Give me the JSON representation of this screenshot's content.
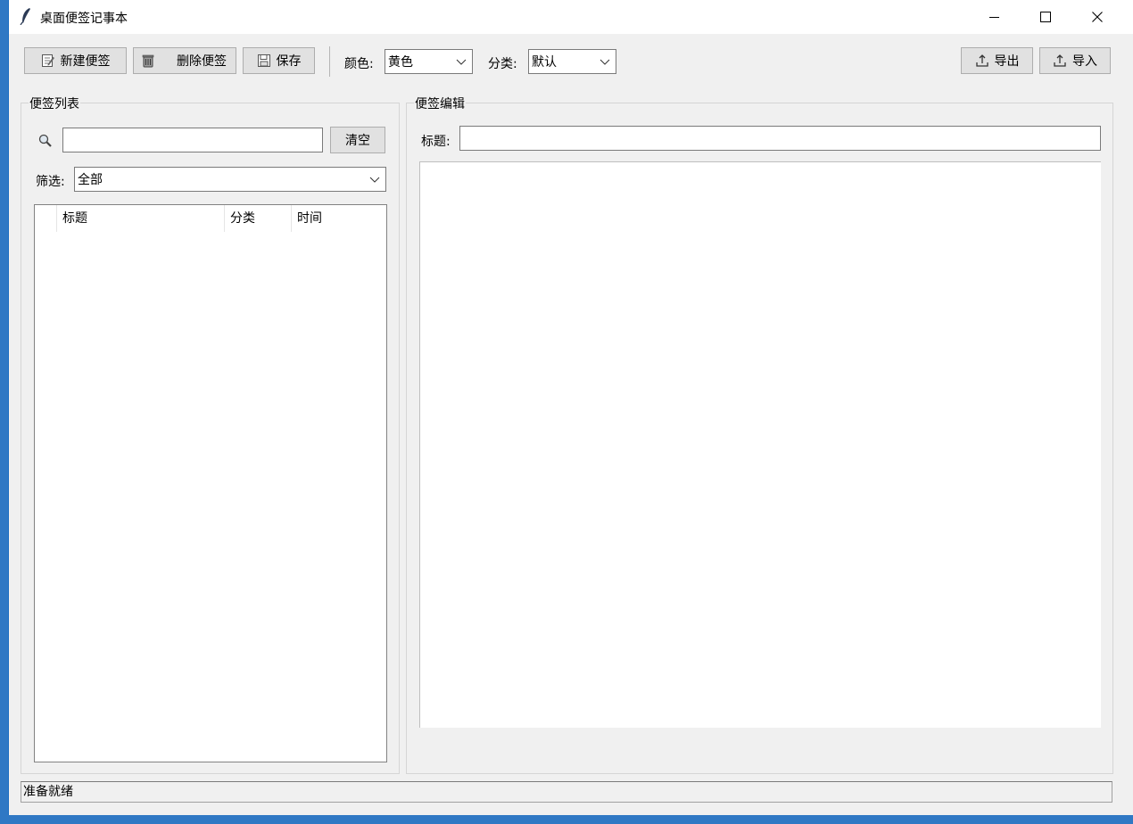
{
  "window": {
    "title": "桌面便签记事本",
    "icon": "feather-icon"
  },
  "toolbar": {
    "new_label": "新建便签",
    "delete_label": "删除便签",
    "save_label": "保存",
    "color_label": "颜色:",
    "color_value": "黄色",
    "category_label": "分类:",
    "category_value": "默认",
    "export_label": "导出",
    "import_label": "导入"
  },
  "list_panel": {
    "title": "便签列表",
    "search_value": "",
    "clear_label": "清空",
    "filter_label": "筛选:",
    "filter_value": "全部",
    "columns": [
      "标题",
      "分类",
      "时间"
    ],
    "rows": []
  },
  "editor_panel": {
    "title": "便签编辑",
    "title_label": "标题:",
    "title_value": "",
    "content": ""
  },
  "status": {
    "text": "准备就绪"
  }
}
